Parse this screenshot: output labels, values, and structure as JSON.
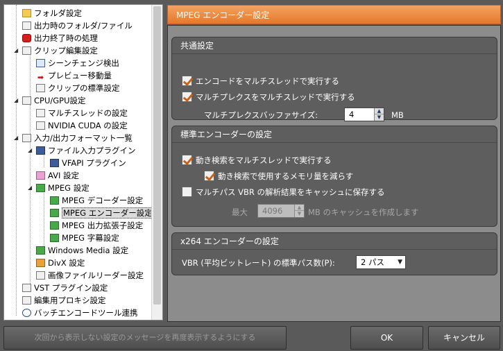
{
  "tree": {
    "items": [
      {
        "label": "フォルダ設定",
        "icon": "folder-icon"
      },
      {
        "label": "出力時のフォルダ/ファイル",
        "icon": "folder-file-icon"
      },
      {
        "label": "出力終了時の処理",
        "icon": "stop-icon"
      },
      {
        "label": "クリップ編集設定",
        "icon": "clip-edit-icon"
      },
      {
        "label": "シーンチェンジ検出",
        "icon": "scene-change-icon"
      },
      {
        "label": "プレビュー移動量",
        "icon": "arrow-icon"
      },
      {
        "label": "クリップの標準設定",
        "icon": "clip-default-icon"
      },
      {
        "label": "CPU/GPU設定",
        "icon": "cpu-icon"
      },
      {
        "label": "マルチスレッドの設定",
        "icon": "doc-icon"
      },
      {
        "label": "NVIDIA CUDA の設定",
        "icon": "doc-icon"
      },
      {
        "label": "入力/出力フォーマット一覧",
        "icon": "list-icon"
      },
      {
        "label": "ファイル入力プラグイン",
        "icon": "monitor-icon"
      },
      {
        "label": "VFAPI プラグイン",
        "icon": "monitor-icon"
      },
      {
        "label": "AVI 設定",
        "icon": "avi-icon"
      },
      {
        "label": "MPEG 設定",
        "icon": "mpeg-icon"
      },
      {
        "label": "MPEG デコーダー設定",
        "icon": "mpeg-icon"
      },
      {
        "label": "MPEG エンコーダー設定",
        "icon": "mpeg-icon"
      },
      {
        "label": "MPEG 出力拡張子設定",
        "icon": "mpeg-icon"
      },
      {
        "label": "MPEG 字幕設定",
        "icon": "mpeg-icon"
      },
      {
        "label": "Windows Media 設定",
        "icon": "wm-icon"
      },
      {
        "label": "DivX 設定",
        "icon": "divx-icon"
      },
      {
        "label": "画像ファイルリーダー設定",
        "icon": "image-icon"
      },
      {
        "label": "VST プラグイン設定",
        "icon": "vst-icon"
      },
      {
        "label": "編集用プロキシ設定",
        "icon": "proxy-icon"
      },
      {
        "label": "バッチエンコードツール連携",
        "icon": "clock-icon"
      }
    ],
    "selected_index": 16
  },
  "header": {
    "title": "MPEG エンコーダー設定"
  },
  "common": {
    "title": "共通設定",
    "multithread_encode": {
      "label": "エンコードをマルチスレッドで実行する",
      "checked": true
    },
    "multithread_mux": {
      "label": "マルチプレクスをマルチスレッドで実行する",
      "checked": true
    },
    "mux_buffer_label": "マルチプレクスバッファサイズ:",
    "mux_buffer_value": "4",
    "mux_buffer_unit": "MB"
  },
  "standard": {
    "title": "標準エンコーダーの設定",
    "motion_multithread": {
      "label": "動き検索をマルチスレッドで実行する",
      "checked": true
    },
    "reduce_memory": {
      "label": "動き検索で使用するメモリ量を減らす",
      "checked": true
    },
    "multipass_cache": {
      "label": "マルチパス VBR の解析結果をキャッシュに保存する",
      "checked": false
    },
    "max_label": "最大",
    "cache_value": "4096",
    "cache_unit": "MB のキャッシュを作成します"
  },
  "x264": {
    "title": "x264 エンコーダーの設定",
    "vbr_label": "VBR (平均ビットレート) の標準パス数(P):",
    "vbr_value": "2 パス"
  },
  "buttons": {
    "message_reset": "次回から表示しない設定のメッセージを再度表示するようにする",
    "ok": "OK",
    "cancel": "キャンセル"
  },
  "colors": {
    "accent": "#e57b2c",
    "check": "#c8601a"
  }
}
